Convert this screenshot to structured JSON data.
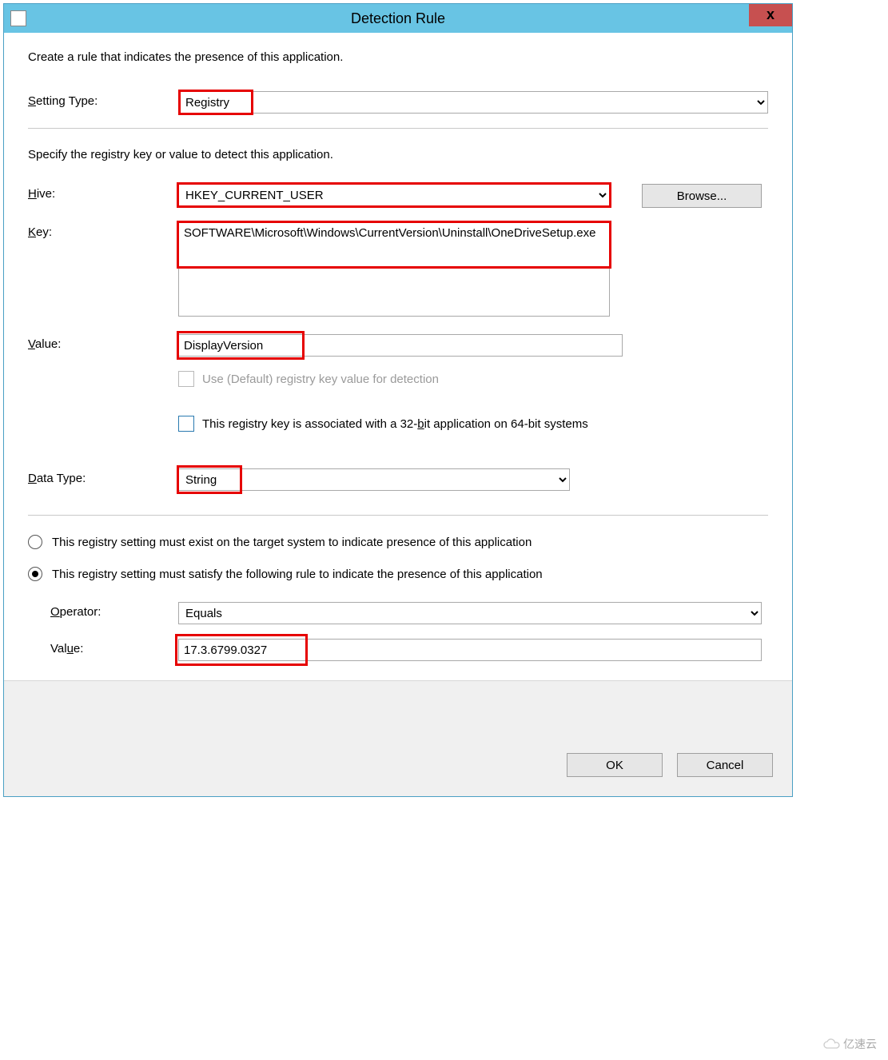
{
  "window": {
    "title": "Detection Rule",
    "close": "x"
  },
  "intro": "Create a rule that indicates the presence of this application.",
  "settingType": {
    "label": "Setting Type:",
    "labelU": "S",
    "value": "Registry"
  },
  "registry": {
    "specify": "Specify the registry key or value to detect this application.",
    "hiveLabel": "Hive:",
    "hiveU": "H",
    "hive": "HKEY_CURRENT_USER",
    "keyLabel": "Key:",
    "keyU": "K",
    "key": "SOFTWARE\\Microsoft\\Windows\\CurrentVersion\\Uninstall\\OneDriveSetup.exe",
    "browse": "Browse...",
    "valueLabel": "Value:",
    "valueU": "V",
    "value": "DisplayVersion",
    "defaultLabel": "Use (Default) registry key value for detection",
    "assoc_pre": "This registry key is associated with a 32-",
    "assoc_u": "b",
    "assoc_post": "it application on 64-bit systems",
    "dataTypeLabel": "Data Type:",
    "dataTypeU": "D",
    "dataType": "String"
  },
  "rule": {
    "opt1": "This registry setting must exist on the target system to indicate presence of this application",
    "opt2": "This registry setting must satisfy the following rule to indicate the presence of this application",
    "operatorLabel": "Operator:",
    "operatorU": "O",
    "operator": "Equals",
    "valueLabel": "Value:",
    "valueU": "u",
    "value": "17.3.6799.0327"
  },
  "buttons": {
    "ok": "OK",
    "cancel": "Cancel"
  },
  "watermark": "亿速云"
}
